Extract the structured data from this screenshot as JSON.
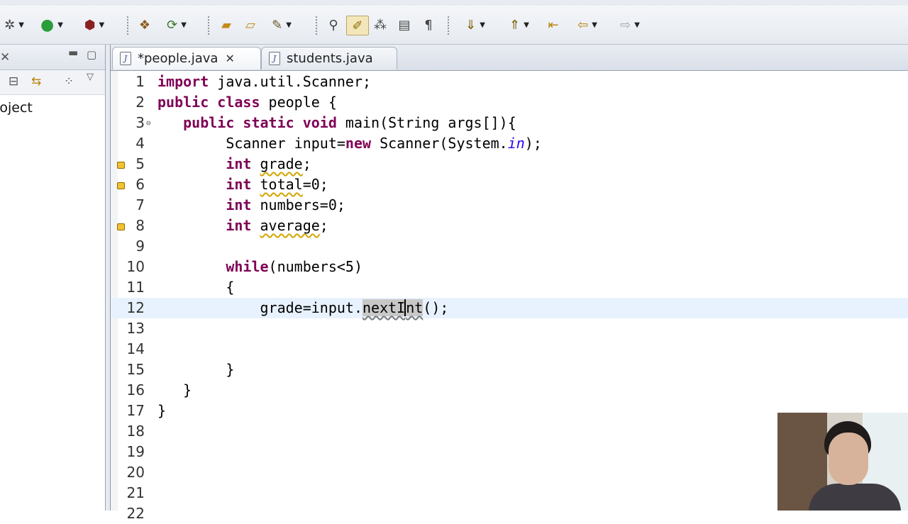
{
  "toolbar": {
    "buttons": [
      "run-icon",
      "debug-icon",
      "new-java-project-icon",
      "open-type-icon",
      "search-icon",
      "toggle-mark-occurrences-icon",
      "next-annotation-icon",
      "previous-annotation-icon",
      "back-icon",
      "forward-icon"
    ]
  },
  "left_panel": {
    "tree_item": "roject"
  },
  "tabs": [
    {
      "label": "*people.java",
      "active": true
    },
    {
      "label": "students.java",
      "active": false
    }
  ],
  "editor": {
    "current_line": 12,
    "lines": [
      {
        "n": "1",
        "tokens": [
          {
            "t": "import",
            "k": "kw"
          },
          {
            "t": " java.util.Scanner;",
            "k": ""
          }
        ]
      },
      {
        "n": "2",
        "tokens": [
          {
            "t": "public",
            "k": "kw"
          },
          {
            "t": " ",
            "k": ""
          },
          {
            "t": "class",
            "k": "kw"
          },
          {
            "t": " people {",
            "k": ""
          }
        ]
      },
      {
        "n": "3",
        "fold": true,
        "tokens": [
          {
            "t": "   ",
            "k": ""
          },
          {
            "t": "public",
            "k": "kw"
          },
          {
            "t": " ",
            "k": ""
          },
          {
            "t": "static",
            "k": "kw"
          },
          {
            "t": " ",
            "k": ""
          },
          {
            "t": "void",
            "k": "kw"
          },
          {
            "t": " main(String args[]){",
            "k": ""
          }
        ]
      },
      {
        "n": "4",
        "tokens": [
          {
            "t": "        Scanner input=",
            "k": ""
          },
          {
            "t": "new",
            "k": "kw"
          },
          {
            "t": " Scanner(System.",
            "k": ""
          },
          {
            "t": "in",
            "k": "it"
          },
          {
            "t": ");",
            "k": ""
          }
        ]
      },
      {
        "n": "5",
        "warn": true,
        "tokens": [
          {
            "t": "        ",
            "k": ""
          },
          {
            "t": "int",
            "k": "kw"
          },
          {
            "t": " ",
            "k": ""
          },
          {
            "t": "grade",
            "k": "sq"
          },
          {
            "t": ";",
            "k": ""
          }
        ]
      },
      {
        "n": "6",
        "warn": true,
        "tokens": [
          {
            "t": "        ",
            "k": ""
          },
          {
            "t": "int",
            "k": "kw"
          },
          {
            "t": " ",
            "k": ""
          },
          {
            "t": "total",
            "k": "sq"
          },
          {
            "t": "=0;",
            "k": ""
          }
        ]
      },
      {
        "n": "7",
        "tokens": [
          {
            "t": "        ",
            "k": ""
          },
          {
            "t": "int",
            "k": "kw"
          },
          {
            "t": " numbers=0;",
            "k": ""
          }
        ]
      },
      {
        "n": "8",
        "warn": true,
        "tokens": [
          {
            "t": "        ",
            "k": ""
          },
          {
            "t": "int",
            "k": "kw"
          },
          {
            "t": " ",
            "k": ""
          },
          {
            "t": "average",
            "k": "sq"
          },
          {
            "t": ";",
            "k": ""
          }
        ]
      },
      {
        "n": "9",
        "tokens": []
      },
      {
        "n": "10",
        "tokens": [
          {
            "t": "        ",
            "k": ""
          },
          {
            "t": "while",
            "k": "kw"
          },
          {
            "t": "(numbers<5)",
            "k": ""
          }
        ]
      },
      {
        "n": "11",
        "tokens": [
          {
            "t": "        {",
            "k": ""
          }
        ]
      },
      {
        "n": "12",
        "tokens": [
          {
            "t": "            grade=input.",
            "k": ""
          },
          {
            "t": "nextI",
            "k": "occ"
          },
          {
            "t": "",
            "k": "caret"
          },
          {
            "t": "nt",
            "k": "occ"
          },
          {
            "t": "();",
            "k": ""
          }
        ]
      },
      {
        "n": "13",
        "tokens": []
      },
      {
        "n": "14",
        "tokens": []
      },
      {
        "n": "15",
        "tokens": [
          {
            "t": "        }",
            "k": ""
          }
        ]
      },
      {
        "n": "16",
        "tokens": [
          {
            "t": "   }",
            "k": ""
          }
        ]
      },
      {
        "n": "17",
        "tokens": [
          {
            "t": "}",
            "k": ""
          }
        ]
      },
      {
        "n": "18",
        "tokens": []
      },
      {
        "n": "19",
        "tokens": []
      },
      {
        "n": "20",
        "tokens": []
      },
      {
        "n": "21",
        "tokens": []
      },
      {
        "n": "22",
        "tokens": []
      }
    ]
  }
}
